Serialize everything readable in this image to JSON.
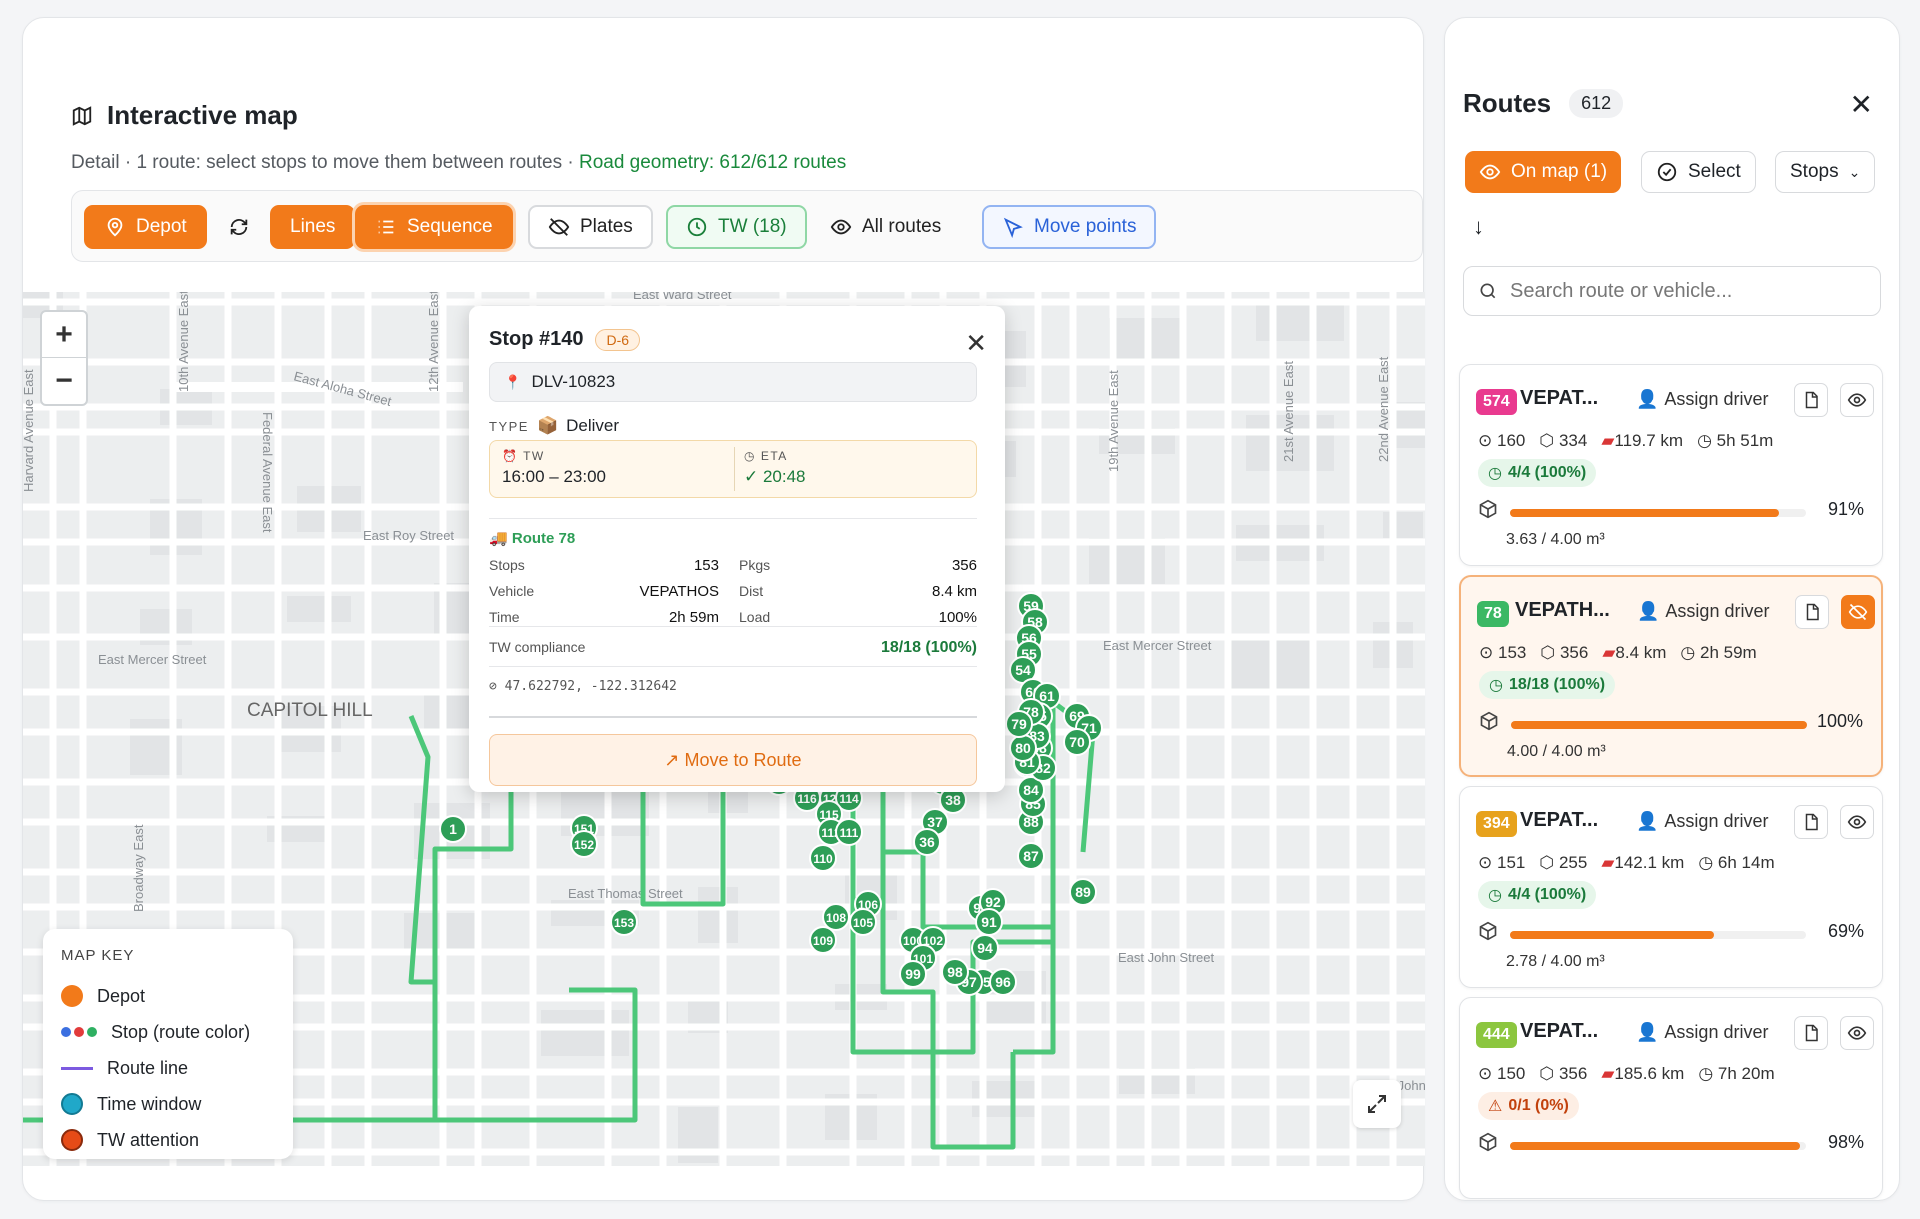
{
  "map_panel": {
    "title": "Interactive map",
    "subtitle": "Detail · 1 route: select stops to move them between routes · ",
    "geometry": "Road geometry: 612/612 routes",
    "toolbar": {
      "depot": "Depot",
      "lines": "Lines",
      "sequence": "Sequence",
      "plates": "Plates",
      "tw": "TW (18)",
      "all_routes": "All routes",
      "move_points": "Move points"
    },
    "map_labels": {
      "district": "CAPITOL HILL",
      "streets": [
        "East Ward Street",
        "East Aloha Street",
        "East Roy Street",
        "East Mercer Street",
        "East Mercer Street",
        "East Thomas Street",
        "East John Street",
        "East John Street",
        "Broadway East",
        "10th Avenue East",
        "12th Avenue East",
        "19th Avenue East",
        "Federal Avenue East",
        "Harvard Avenue East",
        "21st Avenue East",
        "22nd Avenue East"
      ]
    },
    "map_key": {
      "title": "MAP KEY",
      "items": [
        "Depot",
        "Stop (route color)",
        "Route line",
        "Time window",
        "TW attention"
      ]
    }
  },
  "stop_popup": {
    "title": "Stop #140",
    "badge": "D-6",
    "order_id": "DLV-10823",
    "type_label": "TYPE",
    "type_value": "Deliver",
    "tw_label": "TW",
    "tw_value": "16:00 – 23:00",
    "eta_label": "ETA",
    "eta_value": "✓ 20:48",
    "route": "Route 78",
    "rows": [
      {
        "k": "Stops",
        "v": "153",
        "k2": "Pkgs",
        "v2": "356"
      },
      {
        "k": "Vehicle",
        "v": "VEPATHOS",
        "k2": "Dist",
        "v2": "8.4 km"
      },
      {
        "k": "Time",
        "v": "2h 59m",
        "k2": "Load",
        "v2": "100%"
      }
    ],
    "compliance_label": "TW compliance",
    "compliance_value": "18/18 (100%)",
    "coords": "47.622792, -122.312642",
    "move_button": "↗ Move to Route"
  },
  "routes_panel": {
    "title": "Routes",
    "count": "612",
    "on_map": "On map (1)",
    "select": "Select",
    "stops": "Stops",
    "search_placeholder": "Search route or vehicle...",
    "cards": [
      {
        "num": "574",
        "color": "#e93a8f",
        "name": "VEPAT...",
        "assign": "Assign driver",
        "stops": "160",
        "pkgs": "334",
        "dist": "119.7 km",
        "time": "5h 51m",
        "tw": "4/4 (100%)",
        "tw_ok": true,
        "load_pct": 91,
        "pct": "91%",
        "cap": "3.63 / 4.00 m³",
        "selected": false
      },
      {
        "num": "78",
        "color": "#3bb864",
        "name": "VEPATH...",
        "assign": "Assign driver",
        "stops": "153",
        "pkgs": "356",
        "dist": "8.4 km",
        "time": "2h 59m",
        "tw": "18/18 (100%)",
        "tw_ok": true,
        "load_pct": 100,
        "pct": "100%",
        "cap": "4.00 / 4.00 m³",
        "selected": true
      },
      {
        "num": "394",
        "color": "#e7a21d",
        "name": "VEPAT...",
        "assign": "Assign driver",
        "stops": "151",
        "pkgs": "255",
        "dist": "142.1 km",
        "time": "6h 14m",
        "tw": "4/4 (100%)",
        "tw_ok": true,
        "load_pct": 69,
        "pct": "69%",
        "cap": "2.78 / 4.00 m³",
        "selected": false
      },
      {
        "num": "444",
        "color": "#8cc63f",
        "name": "VEPAT...",
        "assign": "Assign driver",
        "stops": "150",
        "pkgs": "356",
        "dist": "185.6 km",
        "time": "7h 20m",
        "tw": "0/1 (0%)",
        "tw_ok": false,
        "load_pct": 98,
        "pct": "98%",
        "cap": "",
        "selected": false
      }
    ]
  },
  "colors": {
    "accent": "#f27a1a",
    "route_green": "#3bb864",
    "stop_green": "#2e9e57"
  }
}
